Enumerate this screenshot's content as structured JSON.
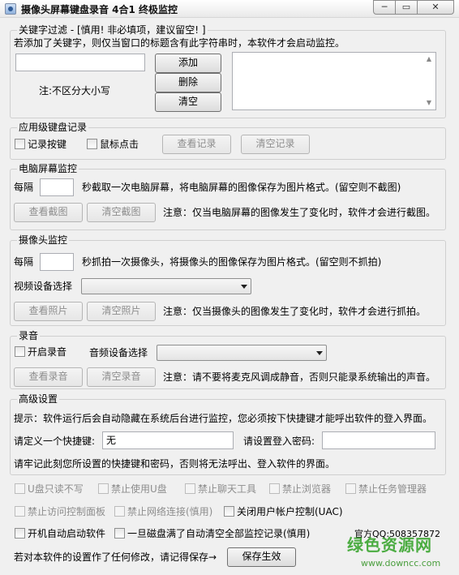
{
  "window": {
    "title": "摄像头屏幕键盘录音 4合1 终极监控",
    "min_glyph": "─",
    "max_glyph": "▭",
    "close_glyph": "✕",
    "icon": "camera-app-icon"
  },
  "keyword": {
    "group_title": "关键字过滤 - [慎用! 非必填项，建议留空! ]",
    "description": "若添加了关键字，则仅当窗口的标题含有此字符串时，本软件才会启动监控。",
    "input_value": "",
    "add_label": "添加",
    "delete_label": "删除",
    "clear_label": "清空",
    "case_note": "注:不区分大小写"
  },
  "app_keylog": {
    "group_title": "应用级键盘记录",
    "record_keys_label": "记录按键",
    "mouse_click_label": "鼠标点击",
    "view_label": "查看记录",
    "clear_label": "清空记录"
  },
  "screen": {
    "group_title": "电脑屏幕监控",
    "every_label": "每隔",
    "interval_value": "",
    "interval_desc": "秒截取一次电脑屏幕，将电脑屏幕的图像保存为图片格式。(留空则不截图)",
    "view_label": "查看截图",
    "clear_label": "清空截图",
    "note": "注意：仅当电脑屏幕的图像发生了变化时，软件才会进行截图。"
  },
  "camera": {
    "group_title": "摄像头监控",
    "every_label": "每隔",
    "interval_value": "",
    "interval_desc": "秒抓拍一次摄像头，将摄像头的图像保存为图片格式。(留空则不抓拍)",
    "device_label": "视频设备选择",
    "device_value": "",
    "view_label": "查看照片",
    "clear_label": "清空照片",
    "note": "注意：仅当摄像头的图像发生了变化时，软件才会进行抓拍。"
  },
  "audio": {
    "group_title": "录音",
    "enable_label": "开启录音",
    "device_label": "音频设备选择",
    "device_value": "",
    "view_label": "查看录音",
    "clear_label": "清空录音",
    "note": "注意：请不要将麦克风调成静音，否则只能录系统输出的声音。"
  },
  "advanced": {
    "group_title": "高级设置",
    "hint": "提示：软件运行后会自动隐藏在系统后台进行监控，您必须按下快捷键才能呼出软件的登入界面。",
    "hotkey_label": "请定义一个快捷键:",
    "hotkey_value": "无",
    "password_label": "请设置登入密码:",
    "password_value": "",
    "remember_note": "请牢记此刻您所设置的快捷键和密码，否则将无法呼出、登入软件的界面。"
  },
  "options": {
    "usb_readonly": "U盘只读不写",
    "disable_usb": "禁止使用U盘",
    "disable_chat": "禁止聊天工具",
    "disable_browser": "禁止浏览器",
    "disable_taskmgr": "禁止任务管理器",
    "disable_cpl": "禁止访问控制面板",
    "disable_network": "禁止网络连接(慎用)",
    "disable_uac": "关闭用户帐户控制(UAC)",
    "autostart": "开机自动启动软件",
    "auto_clear": "一旦磁盘满了自动清空全部监控记录(慎用)",
    "official_qq": "官方QQ:508357872"
  },
  "footer": {
    "save_note": "若对本软件的设置作了任何修改，请记得保存→",
    "save_label": "保存生效"
  },
  "watermark": {
    "logo": "绿色资源网",
    "url": "www.downcc.com"
  }
}
